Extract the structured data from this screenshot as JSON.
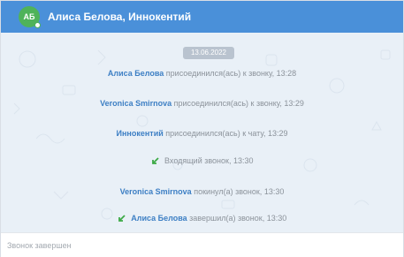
{
  "header": {
    "avatar_initials": "АБ",
    "title": "Алиса Белова, Иннокентий",
    "color": "#4a90d9"
  },
  "chat": {
    "date": "13.06.2022",
    "events": [
      {
        "name": "Алиса Белова",
        "text": "присоединился(ась) к звонку, 13:28"
      },
      {
        "name": "Veronica Smirnova",
        "text": "присоединился(ась) к звонку, 13:29"
      },
      {
        "name": "Иннокентий",
        "text": "присоединился(ась) к чату, 13:29"
      },
      {
        "icon": "incoming-call-icon",
        "text": "Входящий звонок, 13:30"
      },
      {
        "name": "Veronica Smirnova",
        "text": "покинул(а) звонок, 13:30"
      },
      {
        "icon": "incoming-call-icon",
        "name": "Алиса Белова",
        "text": "завершил(а) звонок, 13:30"
      }
    ],
    "name_color": "#3d7fc4",
    "call_icon_color": "#3daa47"
  },
  "footer": {
    "status_text": "Звонок завершен"
  }
}
